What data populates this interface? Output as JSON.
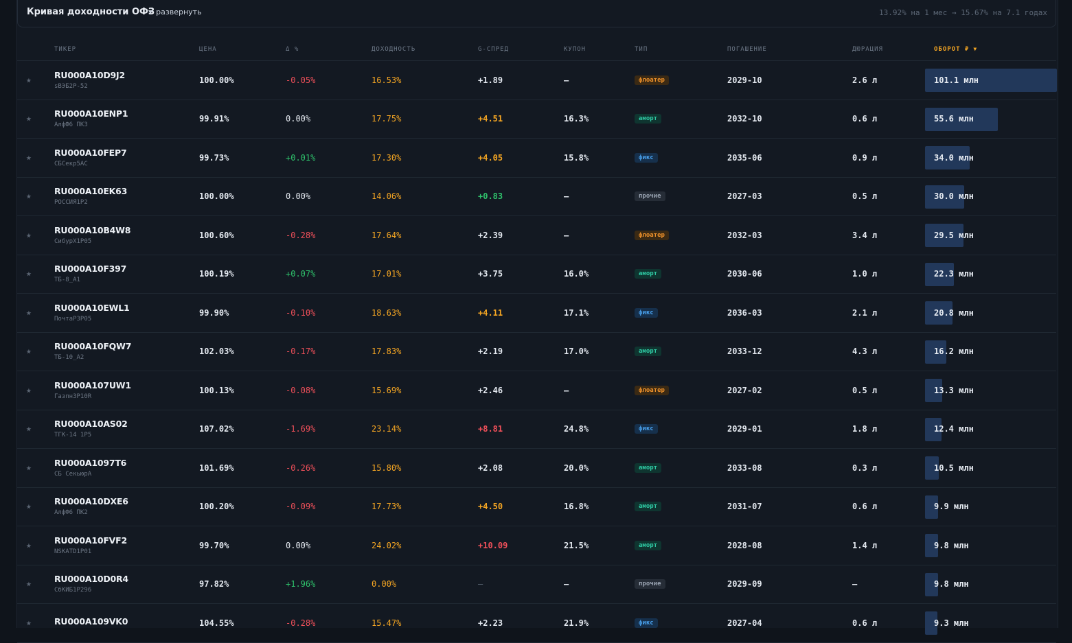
{
  "curve": {
    "title": "Кривая доходности ОФЗ",
    "expand_label": "развернуть",
    "summary": "13.92% на 1 мес → 15.67% на 7.1 годах"
  },
  "columns": {
    "ticker": "ТИКЕР",
    "price": "ЦЕНА",
    "change": "Δ %",
    "yield": "ДОХОДНОСТЬ",
    "gspread": "G-СПРЕД",
    "coupon": "КУПОН",
    "type": "ТИП",
    "maturity": "ПОГАШЕНИЕ",
    "duration": "ДЮРАЦИЯ",
    "volume": "ОБОРОТ ₽"
  },
  "sort": {
    "column": "volume",
    "direction": "desc"
  },
  "colors": {
    "accent": "#f5a623",
    "negative": "#f0505a",
    "positive": "#2fc36c",
    "volume_bar": "#22385a"
  },
  "volume_max": 101.1,
  "rows": [
    {
      "code": "RU000A10D9J2",
      "name": "sВЭБ2Р-52",
      "price": "100.00%",
      "change": "-0.05%",
      "change_dir": "neg",
      "yield": "16.53%",
      "gspread": "+1.89",
      "gspread_tone": "plain",
      "coupon": "—",
      "type": "флоатер",
      "type_key": "floater",
      "maturity": "2029-10",
      "duration": "2.6 л",
      "volume": "101.1 млн",
      "volume_value": 101.1
    },
    {
      "code": "RU000A10ENP1",
      "name": "АлфФ6 ПК3",
      "price": "99.91%",
      "change": "0.00%",
      "change_dir": "zero",
      "yield": "17.75%",
      "gspread": "+4.51",
      "gspread_tone": "warn",
      "coupon": "16.3%",
      "type": "аморт",
      "type_key": "amort",
      "maturity": "2032-10",
      "duration": "0.6 л",
      "volume": "55.6 млн",
      "volume_value": 55.6
    },
    {
      "code": "RU000A10FEP7",
      "name": "СБСекр5АС",
      "price": "99.73%",
      "change": "+0.01%",
      "change_dir": "pos",
      "yield": "17.30%",
      "gspread": "+4.05",
      "gspread_tone": "warn",
      "coupon": "15.8%",
      "type": "фикс",
      "type_key": "fix",
      "maturity": "2035-06",
      "duration": "0.9 л",
      "volume": "34.0 млн",
      "volume_value": 34.0
    },
    {
      "code": "RU000A10EK63",
      "name": "РОССИЯ1Р2",
      "price": "100.00%",
      "change": "0.00%",
      "change_dir": "zero",
      "yield": "14.06%",
      "gspread": "+0.83",
      "gspread_tone": "pos",
      "coupon": "—",
      "type": "прочие",
      "type_key": "other",
      "maturity": "2027-03",
      "duration": "0.5 л",
      "volume": "30.0 млн",
      "volume_value": 30.0
    },
    {
      "code": "RU000A10B4W8",
      "name": "СибурХ1Р05",
      "price": "100.60%",
      "change": "-0.28%",
      "change_dir": "neg",
      "yield": "17.64%",
      "gspread": "+2.39",
      "gspread_tone": "plain",
      "coupon": "—",
      "type": "флоатер",
      "type_key": "floater",
      "maturity": "2032-03",
      "duration": "3.4 л",
      "volume": "29.5 млн",
      "volume_value": 29.5
    },
    {
      "code": "RU000A10F397",
      "name": "ТБ-8_А1",
      "price": "100.19%",
      "change": "+0.07%",
      "change_dir": "pos",
      "yield": "17.01%",
      "gspread": "+3.75",
      "gspread_tone": "plain",
      "coupon": "16.0%",
      "type": "аморт",
      "type_key": "amort",
      "maturity": "2030-06",
      "duration": "1.0 л",
      "volume": "22.3 млн",
      "volume_value": 22.3
    },
    {
      "code": "RU000A10EWL1",
      "name": "ПочтаР3Р05",
      "price": "99.90%",
      "change": "-0.10%",
      "change_dir": "neg",
      "yield": "18.63%",
      "gspread": "+4.11",
      "gspread_tone": "warn",
      "coupon": "17.1%",
      "type": "фикс",
      "type_key": "fix",
      "maturity": "2036-03",
      "duration": "2.1 л",
      "volume": "20.8 млн",
      "volume_value": 20.8
    },
    {
      "code": "RU000A10FQW7",
      "name": "ТБ-10_А2",
      "price": "102.03%",
      "change": "-0.17%",
      "change_dir": "neg",
      "yield": "17.83%",
      "gspread": "+2.19",
      "gspread_tone": "plain",
      "coupon": "17.0%",
      "type": "аморт",
      "type_key": "amort",
      "maturity": "2033-12",
      "duration": "4.3 л",
      "volume": "16.2 млн",
      "volume_value": 16.2
    },
    {
      "code": "RU000A107UW1",
      "name": "ГазпнЗР10R",
      "price": "100.13%",
      "change": "-0.08%",
      "change_dir": "neg",
      "yield": "15.69%",
      "gspread": "+2.46",
      "gspread_tone": "plain",
      "coupon": "—",
      "type": "флоатер",
      "type_key": "floater",
      "maturity": "2027-02",
      "duration": "0.5 л",
      "volume": "13.3 млн",
      "volume_value": 13.3
    },
    {
      "code": "RU000A10AS02",
      "name": "ТГК-14 1Р5",
      "price": "107.02%",
      "change": "-1.69%",
      "change_dir": "neg",
      "yield": "23.14%",
      "gspread": "+8.81",
      "gspread_tone": "neg",
      "coupon": "24.8%",
      "type": "фикс",
      "type_key": "fix",
      "maturity": "2029-01",
      "duration": "1.8 л",
      "volume": "12.4 млн",
      "volume_value": 12.4
    },
    {
      "code": "RU000A1097T6",
      "name": "СБ СекьюрА",
      "price": "101.69%",
      "change": "-0.26%",
      "change_dir": "neg",
      "yield": "15.80%",
      "gspread": "+2.08",
      "gspread_tone": "plain",
      "coupon": "20.0%",
      "type": "аморт",
      "type_key": "amort",
      "maturity": "2033-08",
      "duration": "0.3 л",
      "volume": "10.5 млн",
      "volume_value": 10.5
    },
    {
      "code": "RU000A10DXE6",
      "name": "АлфФ6 ПК2",
      "price": "100.20%",
      "change": "-0.09%",
      "change_dir": "neg",
      "yield": "17.73%",
      "gspread": "+4.50",
      "gspread_tone": "warn",
      "coupon": "16.8%",
      "type": "аморт",
      "type_key": "amort",
      "maturity": "2031-07",
      "duration": "0.6 л",
      "volume": "9.9 млн",
      "volume_value": 9.9
    },
    {
      "code": "RU000A10FVF2",
      "name": "NSKATD1P01",
      "price": "99.70%",
      "change": "0.00%",
      "change_dir": "zero",
      "yield": "24.02%",
      "gspread": "+10.09",
      "gspread_tone": "neg",
      "coupon": "21.5%",
      "type": "аморт",
      "type_key": "amort",
      "maturity": "2028-08",
      "duration": "1.4 л",
      "volume": "9.8 млн",
      "volume_value": 9.8
    },
    {
      "code": "RU000A10D0R4",
      "name": "СбКИБ1Р296",
      "price": "97.82%",
      "change": "+1.96%",
      "change_dir": "pos",
      "yield": "0.00%",
      "gspread": "—",
      "gspread_tone": "none",
      "coupon": "—",
      "type": "прочие",
      "type_key": "other",
      "maturity": "2029-09",
      "duration": "—",
      "volume": "9.8 млн",
      "volume_value": 9.8
    },
    {
      "code": "RU000A109VK0",
      "name": "",
      "price": "104.55%",
      "change": "-0.28%",
      "change_dir": "neg",
      "yield": "15.47%",
      "gspread": "+2.23",
      "gspread_tone": "plain",
      "coupon": "21.9%",
      "type": "фикс",
      "type_key": "fix",
      "maturity": "2027-04",
      "duration": "0.6 л",
      "volume": "9.3 млн",
      "volume_value": 9.3
    }
  ]
}
